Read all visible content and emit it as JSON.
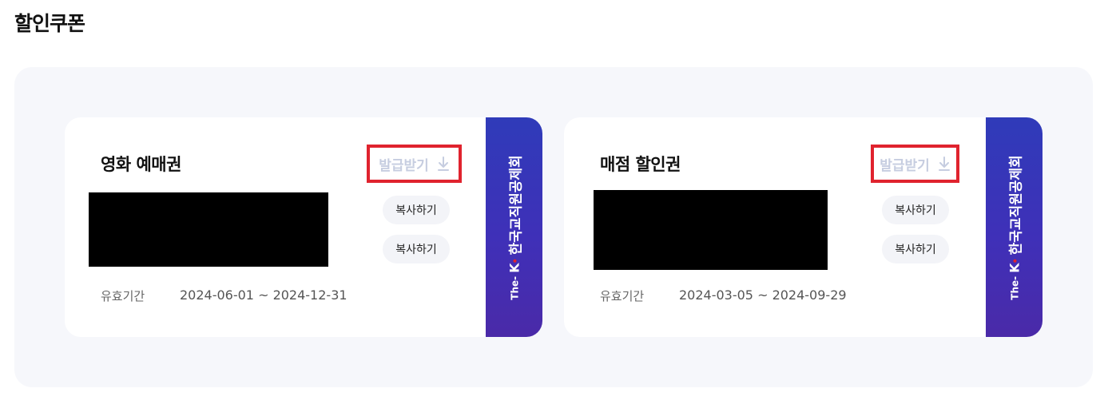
{
  "page": {
    "title": "할인쿠폰"
  },
  "coupons": [
    {
      "name": "영화 예매권",
      "issue_label": "발급받기",
      "copy_buttons": [
        "복사하기",
        "복사하기"
      ],
      "period_label": "유효기간",
      "period_value": "2024-06-01 ~ 2024-12-31",
      "stub": {
        "prefix": "The-",
        "k": "K",
        "org": "한국교직원공제회"
      }
    },
    {
      "name": "매점 할인권",
      "issue_label": "발급받기",
      "copy_buttons": [
        "복사하기",
        "복사하기"
      ],
      "period_label": "유효기간",
      "period_value": "2024-03-05 ~ 2024-09-29",
      "stub": {
        "prefix": "The-",
        "k": "K",
        "org": "한국교직원공제회"
      }
    }
  ],
  "icons": {
    "download": "download-icon"
  },
  "colors": {
    "highlight_border": "#e0232e",
    "issue_text": "#c6cde0",
    "stub_gradient_top": "#2f3bb9",
    "stub_gradient_bottom": "#4a2aa8",
    "area_background": "#f6f7fb"
  }
}
